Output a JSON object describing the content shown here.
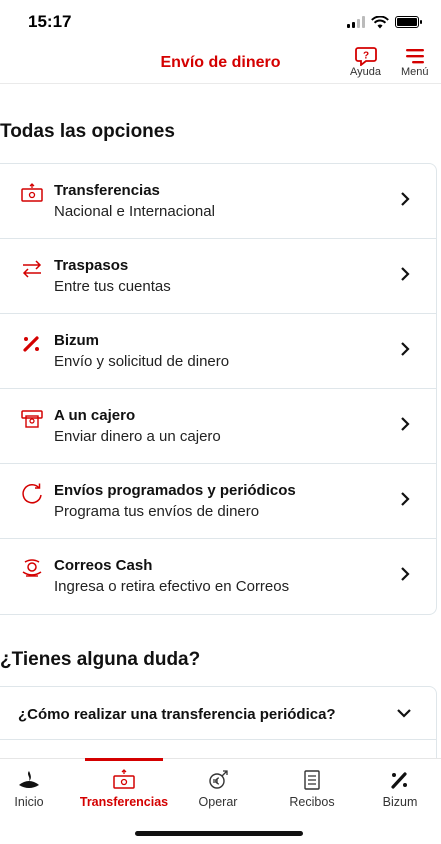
{
  "status": {
    "time": "15:17"
  },
  "header": {
    "title": "Envío de dinero",
    "help_label": "Ayuda",
    "menu_label": "Menú"
  },
  "options_section": {
    "title": "Todas las opciones",
    "items": [
      {
        "icon": "money-transfer-icon",
        "title": "Transferencias",
        "subtitle": "Nacional e Internacional"
      },
      {
        "icon": "swap-arrows-icon",
        "title": "Traspasos",
        "subtitle": "Entre tus cuentas"
      },
      {
        "icon": "bizum-icon",
        "title": "Bizum",
        "subtitle": "Envío y solicitud de dinero"
      },
      {
        "icon": "atm-icon",
        "title": "A un cajero",
        "subtitle": "Enviar dinero a un cajero"
      },
      {
        "icon": "recurring-icon",
        "title": "Envíos programados y periódicos",
        "subtitle": "Programa tus envíos de dinero"
      },
      {
        "icon": "correos-icon",
        "title": "Correos Cash",
        "subtitle": "Ingresa o retira efectivo en Correos"
      }
    ]
  },
  "faq_section": {
    "title": "¿Tienes alguna duda?",
    "questions": [
      {
        "text": "¿Cómo realizar una transferencia periódica?"
      }
    ]
  },
  "tabbar": {
    "active": "Transferencias",
    "tabs": [
      {
        "label": "Inicio",
        "icon": "santander-flame-icon"
      },
      {
        "label": "Transferencias",
        "icon": "money-transfer-icon"
      },
      {
        "label": "Operar",
        "icon": "coins-icon"
      },
      {
        "label": "Recibos",
        "icon": "receipt-icon"
      },
      {
        "label": "Bizum",
        "icon": "bizum-icon"
      }
    ]
  },
  "colors": {
    "brand": "#d40000",
    "text": "#111111",
    "border": "#dfe6ea"
  }
}
